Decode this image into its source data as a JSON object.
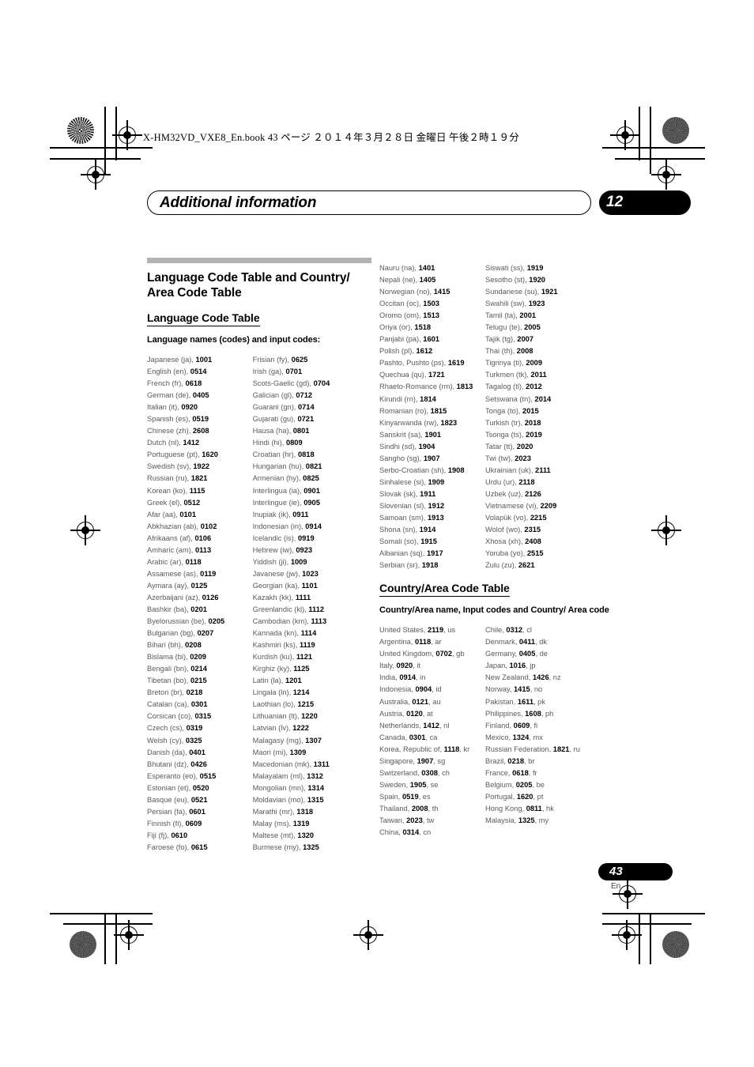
{
  "print_header": {
    "text": "X-HM32VD_VXE8_En.book  43 ページ  ２０１４年３月２８日  金曜日  午後２時１９分"
  },
  "chapter": {
    "title": "Additional information",
    "number": "12"
  },
  "footer": {
    "page_number": "43",
    "language": "En"
  },
  "language_section": {
    "title": "Language Code Table and Country/ Area Code Table",
    "subtitle": "Language Code Table",
    "caption": "Language names (codes) and input codes:",
    "col1": [
      {
        "name": "Japanese (ja), ",
        "code": "1001"
      },
      {
        "name": "English (en), ",
        "code": "0514"
      },
      {
        "name": "French (fr), ",
        "code": "0618"
      },
      {
        "name": "German (de), ",
        "code": "0405"
      },
      {
        "name": "Italian (it), ",
        "code": "0920"
      },
      {
        "name": "Spanish (es), ",
        "code": "0519"
      },
      {
        "name": "Chinese (zh), ",
        "code": "2608"
      },
      {
        "name": "Dutch (nl), ",
        "code": "1412"
      },
      {
        "name": "Portuguese (pt), ",
        "code": "1620"
      },
      {
        "name": "Swedish (sv), ",
        "code": "1922"
      },
      {
        "name": "Russian (ru), ",
        "code": "1821"
      },
      {
        "name": "Korean (ko), ",
        "code": "1115"
      },
      {
        "name": "Greek (el), ",
        "code": "0512"
      },
      {
        "name": "Afar (aa), ",
        "code": "0101"
      },
      {
        "name": "Abkhazian (ab), ",
        "code": "0102"
      },
      {
        "name": "Afrikaans (af), ",
        "code": "0106"
      },
      {
        "name": "Amharic (am), ",
        "code": "0113"
      },
      {
        "name": "Arabic (ar), ",
        "code": "0118"
      },
      {
        "name": "Assamese (as), ",
        "code": "0119"
      },
      {
        "name": "Aymara (ay), ",
        "code": "0125"
      },
      {
        "name": "Azerbaijani (az), ",
        "code": "0126"
      },
      {
        "name": "Bashkir (ba), ",
        "code": "0201"
      },
      {
        "name": "Byelorussian (be), ",
        "code": "0205"
      },
      {
        "name": "Bulgarian (bg), ",
        "code": "0207"
      },
      {
        "name": "Bihari (bh), ",
        "code": "0208"
      },
      {
        "name": "Bislama (bi), ",
        "code": "0209"
      },
      {
        "name": "Bengali (bn), ",
        "code": "0214"
      },
      {
        "name": "Tibetan (bo), ",
        "code": "0215"
      },
      {
        "name": "Breton (br), ",
        "code": "0218"
      },
      {
        "name": "Catalan (ca), ",
        "code": "0301"
      },
      {
        "name": "Corsican (co), ",
        "code": "0315"
      },
      {
        "name": "Czech (cs), ",
        "code": "0319"
      },
      {
        "name": "Welsh (cy), ",
        "code": "0325"
      },
      {
        "name": "Danish (da), ",
        "code": "0401"
      },
      {
        "name": "Bhutani (dz), ",
        "code": "0426"
      },
      {
        "name": "Esperanto (eo), ",
        "code": "0515"
      },
      {
        "name": "Estonian (et), ",
        "code": "0520"
      },
      {
        "name": "Basque (eu), ",
        "code": "0521"
      },
      {
        "name": "Persian (fa), ",
        "code": "0601"
      },
      {
        "name": "Finnish (fi), ",
        "code": "0609"
      },
      {
        "name": "Fiji (fj), ",
        "code": "0610"
      },
      {
        "name": "Faroese (fo), ",
        "code": "0615"
      }
    ],
    "col2": [
      {
        "name": "Frisian (fy), ",
        "code": "0625"
      },
      {
        "name": "Irish (ga), ",
        "code": "0701"
      },
      {
        "name": "Scots-Gaelic (gd), ",
        "code": "0704"
      },
      {
        "name": "Galician (gl), ",
        "code": "0712"
      },
      {
        "name": "Guarani (gn), ",
        "code": "0714"
      },
      {
        "name": "Gujarati (gu), ",
        "code": "0721"
      },
      {
        "name": "Hausa (ha), ",
        "code": "0801"
      },
      {
        "name": "Hindi (hi), ",
        "code": "0809"
      },
      {
        "name": "Croatian (hr), ",
        "code": "0818"
      },
      {
        "name": "Hungarian (hu), ",
        "code": "0821"
      },
      {
        "name": "Armenian (hy), ",
        "code": "0825"
      },
      {
        "name": "Interlingua (ia), ",
        "code": "0901"
      },
      {
        "name": "Interlingue (ie), ",
        "code": "0905"
      },
      {
        "name": "Inupiak (ik), ",
        "code": "0911"
      },
      {
        "name": "Indonesian (in), ",
        "code": "0914"
      },
      {
        "name": "Icelandic (is), ",
        "code": "0919"
      },
      {
        "name": "Hebrew (iw), ",
        "code": "0923"
      },
      {
        "name": "Yiddish (ji), ",
        "code": "1009"
      },
      {
        "name": "Javanese (jw), ",
        "code": "1023"
      },
      {
        "name": "Georgian (ka), ",
        "code": "1101"
      },
      {
        "name": "Kazakh (kk), ",
        "code": "1111"
      },
      {
        "name": "Greenlandic (kl), ",
        "code": "1112"
      },
      {
        "name": "Cambodian (km), ",
        "code": "1113"
      },
      {
        "name": "Kannada (kn), ",
        "code": "1114"
      },
      {
        "name": "Kashmiri (ks), ",
        "code": "1119"
      },
      {
        "name": "Kurdish (ku), ",
        "code": "1121"
      },
      {
        "name": "Kirghiz (ky), ",
        "code": "1125"
      },
      {
        "name": "Latin (la), ",
        "code": "1201"
      },
      {
        "name": "Lingala (ln), ",
        "code": "1214"
      },
      {
        "name": "Laothian (lo), ",
        "code": "1215"
      },
      {
        "name": "Lithuanian (lt), ",
        "code": "1220"
      },
      {
        "name": "Latvian (lv), ",
        "code": "1222"
      },
      {
        "name": "Malagasy (mg), ",
        "code": "1307"
      },
      {
        "name": "Maori (mi), ",
        "code": "1309"
      },
      {
        "name": "Macedonian (mk), ",
        "code": "1311"
      },
      {
        "name": "Malayalam (ml), ",
        "code": "1312"
      },
      {
        "name": "Mongolian (mn), ",
        "code": "1314"
      },
      {
        "name": "Moldavian (mo), ",
        "code": "1315"
      },
      {
        "name": "Marathi (mr), ",
        "code": "1318"
      },
      {
        "name": "Malay (ms), ",
        "code": "1319"
      },
      {
        "name": "Maltese (mt), ",
        "code": "1320"
      },
      {
        "name": "Burmese (my), ",
        "code": "1325"
      }
    ],
    "col3": [
      {
        "name": "Nauru (na), ",
        "code": "1401"
      },
      {
        "name": "Nepali (ne), ",
        "code": "1405"
      },
      {
        "name": "Norwegian (no), ",
        "code": "1415"
      },
      {
        "name": "Occitan (oc), ",
        "code": "1503"
      },
      {
        "name": "Oromo (om), ",
        "code": "1513"
      },
      {
        "name": "Oriya (or), ",
        "code": "1518"
      },
      {
        "name": "Panjabi (pa), ",
        "code": "1601"
      },
      {
        "name": "Polish (pl), ",
        "code": "1612"
      },
      {
        "name": "Pashto, Pushto (ps), ",
        "code": "1619"
      },
      {
        "name": "Quechua (qu), ",
        "code": "1721"
      },
      {
        "name": "Rhaeto-Romance (rm), ",
        "code": "1813"
      },
      {
        "name": "Kirundi (rn), ",
        "code": "1814"
      },
      {
        "name": "Romanian (ro), ",
        "code": "1815"
      },
      {
        "name": "Kinyarwanda (rw), ",
        "code": "1823"
      },
      {
        "name": "Sanskrit (sa), ",
        "code": "1901"
      },
      {
        "name": "Sindhi (sd), ",
        "code": "1904"
      },
      {
        "name": "Sangho (sg), ",
        "code": "1907"
      },
      {
        "name": "Serbo-Croatian (sh), ",
        "code": "1908"
      },
      {
        "name": "Sinhalese (si), ",
        "code": "1909"
      },
      {
        "name": "Slovak (sk), ",
        "code": "1911"
      },
      {
        "name": "Slovenian (sl), ",
        "code": "1912"
      },
      {
        "name": "Samoan (sm), ",
        "code": "1913"
      },
      {
        "name": "Shona (sn), ",
        "code": "1914"
      },
      {
        "name": "Somali (so), ",
        "code": "1915"
      },
      {
        "name": "Albanian (sq), ",
        "code": "1917"
      },
      {
        "name": "Serbian (sr), ",
        "code": "1918"
      }
    ],
    "col4": [
      {
        "name": "Siswati (ss), ",
        "code": "1919"
      },
      {
        "name": "Sesotho (st), ",
        "code": "1920"
      },
      {
        "name": "Sundanese (su), ",
        "code": "1921"
      },
      {
        "name": "Swahili (sw), ",
        "code": "1923"
      },
      {
        "name": "Tamil (ta), ",
        "code": "2001"
      },
      {
        "name": "Telugu (te), ",
        "code": "2005"
      },
      {
        "name": "Tajik (tg), ",
        "code": "2007"
      },
      {
        "name": "Thai (th), ",
        "code": "2008"
      },
      {
        "name": "Tigrinya (ti), ",
        "code": "2009"
      },
      {
        "name": "Turkmen (tk), ",
        "code": "2011"
      },
      {
        "name": "Tagalog (tl), ",
        "code": "2012"
      },
      {
        "name": "Setswana (tn), ",
        "code": "2014"
      },
      {
        "name": "Tonga (to), ",
        "code": "2015"
      },
      {
        "name": "Turkish (tr), ",
        "code": "2018"
      },
      {
        "name": "Tsonga (ts), ",
        "code": "2019"
      },
      {
        "name": "Tatar (tt), ",
        "code": "2020"
      },
      {
        "name": "Twi (tw), ",
        "code": "2023"
      },
      {
        "name": "Ukrainian (uk), ",
        "code": "2111"
      },
      {
        "name": "Urdu (ur), ",
        "code": "2118"
      },
      {
        "name": "Uzbek (uz), ",
        "code": "2126"
      },
      {
        "name": "Vietnamese (vi), ",
        "code": "2209"
      },
      {
        "name": "Volapük (vo), ",
        "code": "2215"
      },
      {
        "name": "Wolof (wo), ",
        "code": "2315"
      },
      {
        "name": "Xhosa (xh), ",
        "code": "2408"
      },
      {
        "name": "Yoruba (yo), ",
        "code": "2515"
      },
      {
        "name": "Zulu (zu), ",
        "code": "2621"
      }
    ]
  },
  "country_section": {
    "subtitle": "Country/Area Code Table",
    "caption": "Country/Area name, Input codes and Country/ Area code",
    "col1": [
      {
        "name": "United States, ",
        "code": "2119",
        "abbr": ", us"
      },
      {
        "name": "Argentina, ",
        "code": "0118",
        "abbr": ", ar"
      },
      {
        "name": "United Kingdom, ",
        "code": "0702",
        "abbr": ", gb"
      },
      {
        "name": "Italy, ",
        "code": "0920",
        "abbr": ", it"
      },
      {
        "name": "India, ",
        "code": "0914",
        "abbr": ", in"
      },
      {
        "name": "Indonesia, ",
        "code": "0904",
        "abbr": ", id"
      },
      {
        "name": "Australia, ",
        "code": "0121",
        "abbr": ", au"
      },
      {
        "name": "Austria, ",
        "code": "0120",
        "abbr": ", at"
      },
      {
        "name": "Netherlands, ",
        "code": "1412",
        "abbr": ", nl"
      },
      {
        "name": "Canada, ",
        "code": "0301",
        "abbr": ", ca"
      },
      {
        "name": "Korea, Republic of, ",
        "code": "1118",
        "abbr": ", kr"
      },
      {
        "name": "Singapore, ",
        "code": "1907",
        "abbr": ", sg"
      },
      {
        "name": "Switzerland, ",
        "code": "0308",
        "abbr": ", ch"
      },
      {
        "name": "Sweden, ",
        "code": "1905",
        "abbr": ", se"
      },
      {
        "name": "Spain, ",
        "code": "0519",
        "abbr": ", es"
      },
      {
        "name": "Thailand, ",
        "code": "2008",
        "abbr": ", th"
      },
      {
        "name": "Taiwan, ",
        "code": "2023",
        "abbr": ", tw"
      },
      {
        "name": "China, ",
        "code": "0314",
        "abbr": ", cn"
      }
    ],
    "col2": [
      {
        "name": "Chile, ",
        "code": "0312",
        "abbr": ", cl"
      },
      {
        "name": "Denmark, ",
        "code": "0411",
        "abbr": ", dk"
      },
      {
        "name": "Germany, ",
        "code": "0405",
        "abbr": ", de"
      },
      {
        "name": "Japan, ",
        "code": "1016",
        "abbr": ", jp"
      },
      {
        "name": "New Zealand, ",
        "code": "1426",
        "abbr": ", nz"
      },
      {
        "name": "Norway, ",
        "code": "1415",
        "abbr": ", no"
      },
      {
        "name": "Pakistan, ",
        "code": "1611",
        "abbr": ", pk"
      },
      {
        "name": "Philippines, ",
        "code": "1608",
        "abbr": ", ph"
      },
      {
        "name": "Finland, ",
        "code": "0609",
        "abbr": ", fi"
      },
      {
        "name": "Mexico, ",
        "code": "1324",
        "abbr": ", mx"
      },
      {
        "name": "Russian Federation, ",
        "code": "1821",
        "abbr": ", ru"
      },
      {
        "name": "Brazil, ",
        "code": "0218",
        "abbr": ", br"
      },
      {
        "name": "France, ",
        "code": "0618",
        "abbr": ", fr"
      },
      {
        "name": "Belgium, ",
        "code": "0205",
        "abbr": ", be"
      },
      {
        "name": "Portugal, ",
        "code": "1620",
        "abbr": ", pt"
      },
      {
        "name": "Hong Kong, ",
        "code": "0811",
        "abbr": ", hk"
      },
      {
        "name": "Malaysia, ",
        "code": "1325",
        "abbr": ", my"
      }
    ]
  }
}
